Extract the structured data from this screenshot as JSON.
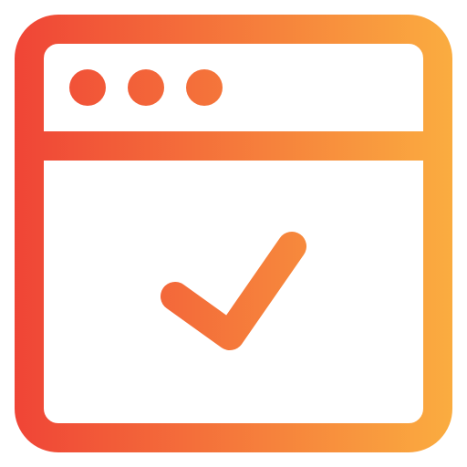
{
  "icon": {
    "name": "browser-window-check-icon",
    "parts": {
      "window": "browser-window-icon",
      "dots": [
        "window-dot-icon",
        "window-dot-icon",
        "window-dot-icon"
      ],
      "check": "checkmark-icon"
    },
    "colors": {
      "gradient_start": "#EF4136",
      "gradient_end": "#FBB040"
    }
  }
}
